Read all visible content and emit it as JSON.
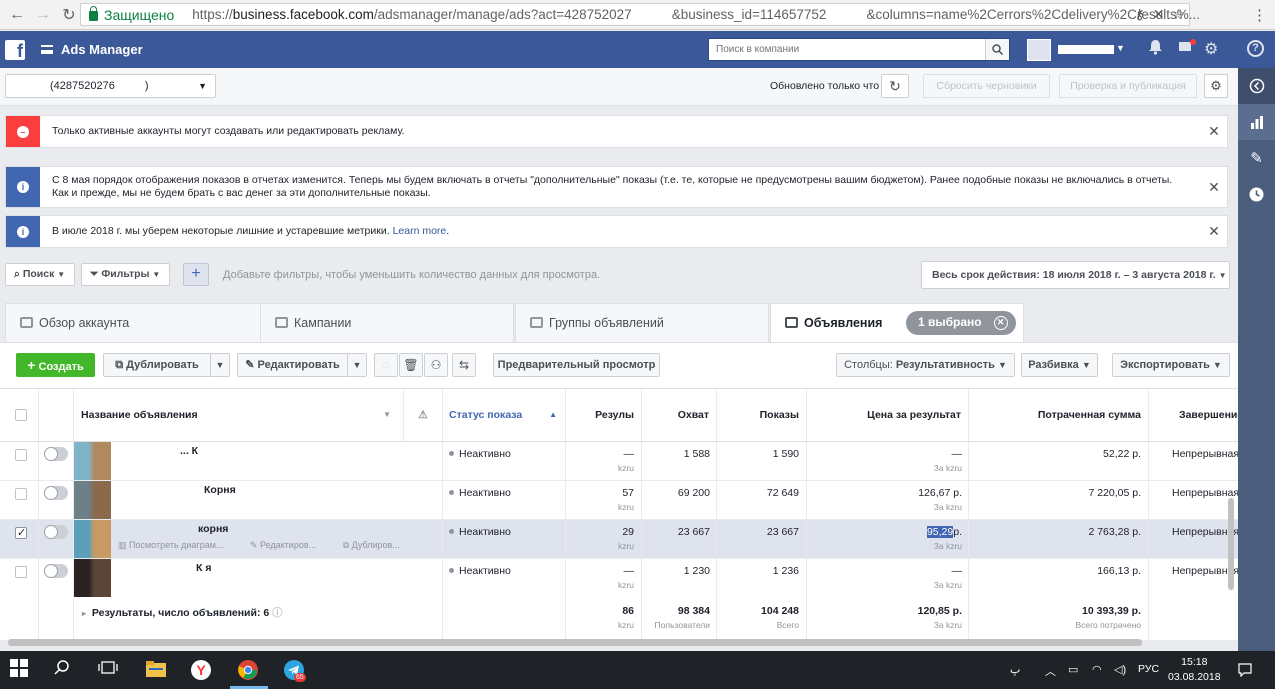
{
  "browser": {
    "secure_label": "Защищено",
    "url_part1": "https://",
    "url_host": "business.facebook.com",
    "url_part2": "/adsmanager/manage/ads?act=428752027",
    "url_part3": "&business_id=114657752",
    "url_part4": "&columns=name%2Cerrors%2Cdelivery%2Cresults%..."
  },
  "header": {
    "logo": "f",
    "app_title": "Ads Manager",
    "search_placeholder": "Поиск в компании"
  },
  "toolbar": {
    "account_id": "(4287520276",
    "account_suffix": ")",
    "updated_text": "Обновлено только что",
    "discard_label": "Сбросить черновики",
    "publish_label": "Проверка и публикация"
  },
  "notices": [
    {
      "type": "error",
      "icon": "minus-circle-icon",
      "text": "Только активные аккаунты могут создавать или редактировать рекламу.",
      "color": "#fa3e3e"
    },
    {
      "type": "info",
      "icon": "info-icon",
      "text": "С 8 мая порядок отображения показов в отчетах изменится. Теперь мы будем включать в отчеты \"дополнительные\" показы (т.е. те, которые не предусмотрены вашим бюджетом). Ранее подобные показы не включались в отчеты. Как и прежде, мы не будем брать с вас денег за эти дополнительные показы.",
      "color": "#4267b2"
    },
    {
      "type": "info",
      "icon": "info-icon",
      "text": "В июле 2018 г. мы уберем некоторые лишние и устаревшие метрики.",
      "link": "Learn more",
      "suffix": ".",
      "color": "#4267b2"
    }
  ],
  "filters": {
    "search_label": "Поиск",
    "filters_label": "Фильтры",
    "hint": "Добавьте фильтры, чтобы уменьшить количество данных для просмотра.",
    "date_range": "Весь срок действия: 18 июля 2018 г. – 3 августа 2018 г."
  },
  "tabs": [
    {
      "label": "Обзор аккаунта"
    },
    {
      "label": "Кампании"
    },
    {
      "label": "Группы объявлений"
    },
    {
      "label": "Объявления",
      "pill": "1 выбрано"
    }
  ],
  "actions": {
    "create": "Создать",
    "duplicate": "Дублировать",
    "edit": "Редактировать",
    "preview": "Предварительный просмотр",
    "columns_prefix": "Столбцы:",
    "columns_value": "Результативность",
    "breakdown": "Разбивка",
    "export": "Экспортировать"
  },
  "table": {
    "columns": {
      "name": "Название объявления",
      "status": "Статус показа",
      "results": "Резулы",
      "reach": "Охват",
      "impressions": "Показы",
      "cost_per_result": "Цена за результат",
      "spent": "Потраченная сумма",
      "ends": "Завершение"
    },
    "rows": [
      {
        "status": "Неактивно",
        "results": "—",
        "results_sub": "kzru",
        "reach": "1 588",
        "impressions": "1 590",
        "cost": "—",
        "cost_sub": "За kzru",
        "spent": "52,22 р.",
        "ends": "Непрерывная",
        "name_tail": "... К",
        "selected": false
      },
      {
        "status": "Неактивно",
        "results": "57",
        "results_sub": "kzru",
        "reach": "69 200",
        "impressions": "72 649",
        "cost": "126,67 р.",
        "cost_sub": "За kzru",
        "spent": "7 220,05 р.",
        "ends": "Непрерывная",
        "name_tail": "Корня",
        "selected": false
      },
      {
        "status": "Неактивно",
        "results": "29",
        "results_sub": "kzru",
        "reach": "23 667",
        "impressions": "23 667",
        "cost_hl": "95,29",
        "cost_tail": "р.",
        "cost_sub": "За kzru",
        "spent": "2 763,28 р.",
        "ends": "Непрерывная",
        "name_tail": "корня",
        "selected": true,
        "hover": [
          "Посмотреть диаграм...",
          "Редактиров...",
          "Дублиров..."
        ]
      },
      {
        "status": "Неактивно",
        "results": "—",
        "results_sub": "kzru",
        "reach": "1 230",
        "impressions": "1 236",
        "cost": "—",
        "cost_sub": "За kzru",
        "spent": "166,13 р.",
        "ends": "Непрерывная",
        "name_tail": "К я",
        "selected": false
      }
    ],
    "summary": {
      "label": "Результаты, число объявлений: 6",
      "results": "86",
      "results_sub": "kzru",
      "reach": "98 384",
      "reach_sub": "Пользователи",
      "impressions": "104 248",
      "impressions_sub": "Всего",
      "cost": "120,85 р.",
      "cost_sub": "За kzru",
      "spent": "10 393,39 р.",
      "spent_sub": "Всего потрачено"
    }
  },
  "taskbar": {
    "lang": "РУС",
    "time": "15:18",
    "date": "03.08.2018",
    "telegram_badge": "65"
  }
}
